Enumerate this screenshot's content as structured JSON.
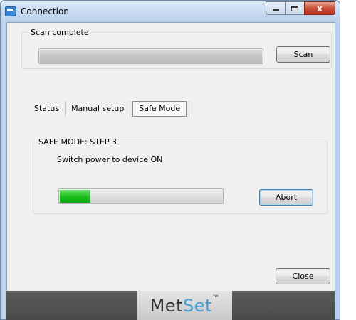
{
  "window": {
    "title": "Connection",
    "app_icon": "app-icon",
    "caption_buttons": {
      "minimize": "minimize-icon",
      "maximize": "maximize-icon",
      "close_glyph": "x"
    }
  },
  "scan": {
    "group_label": "Scan complete",
    "progress_fraction": 1.0,
    "button_label": "Scan"
  },
  "tabs": [
    {
      "label": "Status",
      "selected": false
    },
    {
      "label": "Manual setup",
      "selected": false
    },
    {
      "label": "Safe Mode",
      "selected": true
    }
  ],
  "safe_mode": {
    "group_label": "SAFE MODE: STEP 3",
    "instruction": "Switch power to device ON",
    "progress_fraction": 0.19,
    "progress_color": "#1fbf1f",
    "abort_label": "Abort"
  },
  "close_label": "Close",
  "footer": {
    "logo_part1": "Met",
    "logo_part2": "Set",
    "logo_tm": "™",
    "logo_accent": "#3f9fd8"
  }
}
